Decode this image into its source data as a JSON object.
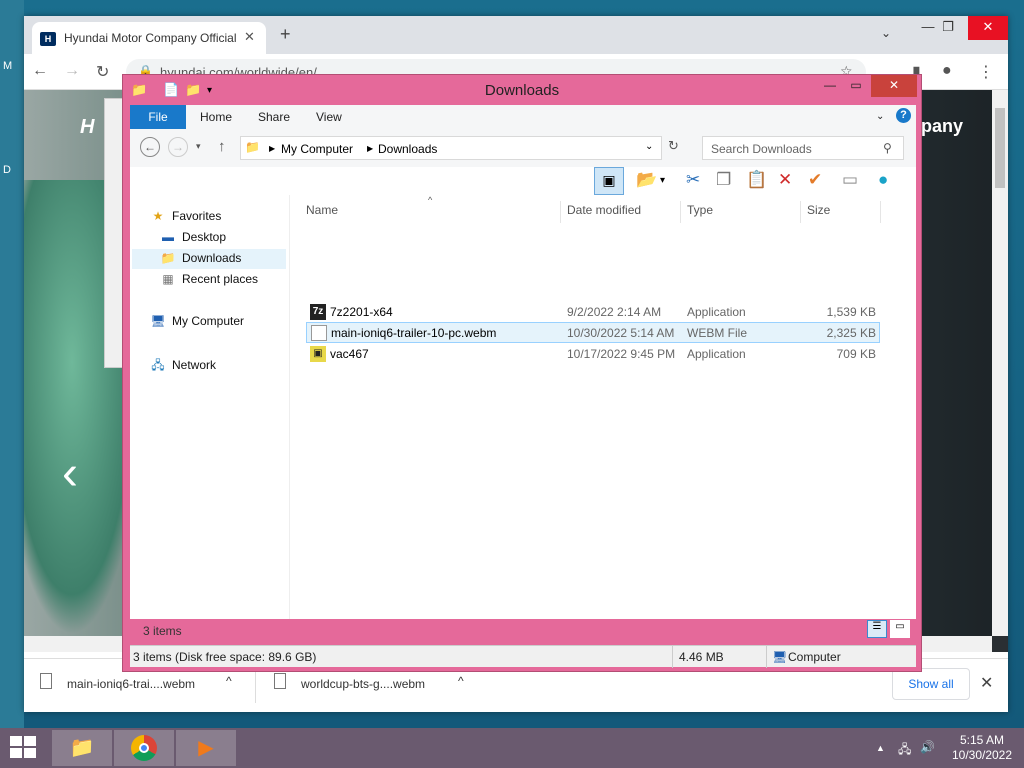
{
  "desktop": {
    "side_label_1": "M",
    "side_label_2": "D"
  },
  "browser": {
    "tab_title": "Hyundai Motor Company Official",
    "tab_favicon": "H",
    "url": "hyundai.com/worldwide/en/",
    "page_brand_text": "ompany",
    "page_logo": "H",
    "downloads": [
      {
        "name": "main-ioniq6-trai....webm"
      },
      {
        "name": "worldcup-bts-g....webm"
      }
    ],
    "show_all": "Show all"
  },
  "explorer": {
    "title": "Downloads",
    "ribbon_tabs": [
      "File",
      "Home",
      "Share",
      "View"
    ],
    "breadcrumb": [
      "My Computer",
      "Downloads"
    ],
    "search_placeholder": "Search Downloads",
    "nav": {
      "favorites": "Favorites",
      "desktop": "Desktop",
      "downloads": "Downloads",
      "recent": "Recent places",
      "computer": "My Computer",
      "network": "Network"
    },
    "columns": [
      "Name",
      "Date modified",
      "Type",
      "Size"
    ],
    "files": [
      {
        "name": "7z2201-x64",
        "date": "9/2/2022 2:14 AM",
        "type": "Application",
        "size": "1,539 KB",
        "icon": "7z-icon"
      },
      {
        "name": "main-ioniq6-trailer-10-pc.webm",
        "date": "10/30/2022 5:14 AM",
        "type": "WEBM File",
        "size": "2,325 KB",
        "icon": "file-icon"
      },
      {
        "name": "vac467",
        "date": "10/17/2022 9:45 PM",
        "type": "Application",
        "size": "709 KB",
        "icon": "app-icon"
      }
    ],
    "item_count": "3 items",
    "status_left": "3 items (Disk free space: 89.6 GB)",
    "status_size": "4.46 MB",
    "status_location": "Computer"
  },
  "taskbar": {
    "time": "5:15 AM",
    "date": "10/30/2022"
  }
}
